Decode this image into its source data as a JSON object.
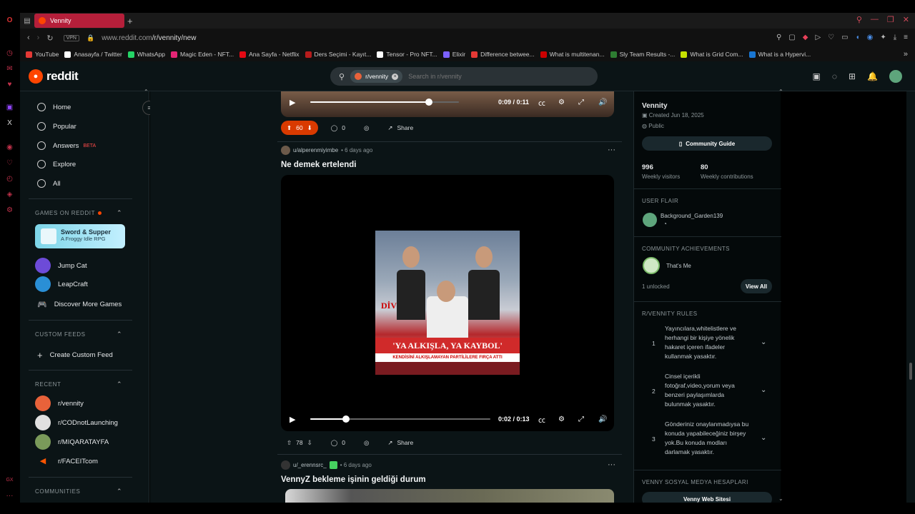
{
  "browser": {
    "tab_title": "Vennity",
    "url_host": "www.reddit.com",
    "url_path": "/r/vennity/new",
    "vpn_label": "VPN",
    "bookmarks": [
      {
        "label": "YouTube",
        "color": "#e53935"
      },
      {
        "label": "Anasayfa / Twitter",
        "color": "#ffffff"
      },
      {
        "label": "WhatsApp",
        "color": "#25d366"
      },
      {
        "label": "Magic Eden - NFT...",
        "color": "#e42575"
      },
      {
        "label": "Ana Sayfa - Netflix",
        "color": "#e50914"
      },
      {
        "label": "Ders Seçimi - Kayıt...",
        "color": "#b71c1c"
      },
      {
        "label": "Tensor - Pro NFT...",
        "color": "#ffffff"
      },
      {
        "label": "Elixir",
        "color": "#7b61ff"
      },
      {
        "label": "Difference betwee...",
        "color": "#e53935"
      },
      {
        "label": "What is multitenan...",
        "color": "#cc0000"
      },
      {
        "label": "Sly Team Results -...",
        "color": "#2e7d32"
      },
      {
        "label": "What is Grid Com...",
        "color": "#c6e000"
      },
      {
        "label": "What is a Hypervi...",
        "color": "#1976d2"
      }
    ]
  },
  "header": {
    "logo_text": "reddit",
    "search_chip": "r/vennity",
    "search_placeholder": "Search in r/vennity"
  },
  "sidebar": {
    "nav": [
      {
        "label": "Home"
      },
      {
        "label": "Popular"
      },
      {
        "label": "Answers",
        "badge": "BETA"
      },
      {
        "label": "Explore"
      },
      {
        "label": "All"
      }
    ],
    "games_heading": "GAMES ON REDDIT",
    "game_card": {
      "title": "Sword & Supper",
      "subtitle": "A Froggy Idle RPG"
    },
    "games": [
      {
        "label": "Jump Cat",
        "color": "#6d4bd8"
      },
      {
        "label": "LeapCraft",
        "color": "#2a8fd6"
      },
      {
        "label": "Discover More Games",
        "color": ""
      }
    ],
    "custom_feeds_heading": "CUSTOM FEEDS",
    "create_custom_feed": "Create Custom Feed",
    "recent_heading": "RECENT",
    "recent": [
      {
        "label": "r/vennity",
        "color": "#e8623a"
      },
      {
        "label": "r/CODnotLaunching",
        "color": "#e0e0e0"
      },
      {
        "label": "r/MIQARATAYFA",
        "color": "#7a9a5a"
      },
      {
        "label": "r/FACEITcom",
        "color": "#ff5500"
      }
    ],
    "communities_heading": "COMMUNITIES"
  },
  "feed": {
    "post_top": {
      "video_time": "0:09 / 0:11",
      "progress": 0.8,
      "votes": "60",
      "comments": "0",
      "share": "Share"
    },
    "post_main": {
      "author": "u/alperenmiyimbe",
      "age": "• 6 days ago",
      "title": "Ne demek ertelendi",
      "thumb_banner": "'YA ALKIŞLA, YA KAYBOL'",
      "thumb_sub": "KENDİSİNİ ALKIŞLAMAYAN PARTİLİLERE FIRÇA ATTI",
      "thumb_div": "DİV",
      "video_time": "0:02 / 0:13",
      "progress": 0.2,
      "votes": "78",
      "comments": "0",
      "share": "Share"
    },
    "post_next": {
      "author": "u/_erennsrc_",
      "age": "• 6 days ago",
      "title": "VennyZ bekleme işinin geldiği durum"
    }
  },
  "community": {
    "name": "Vennity",
    "created": "Created Jun 18, 2025",
    "visibility": "Public",
    "guide_button": "Community Guide",
    "stats": [
      {
        "value": "996",
        "label": "Weekly visitors"
      },
      {
        "value": "80",
        "label": "Weekly contributions"
      }
    ],
    "user_flair_heading": "USER FLAIR",
    "user_flair_name": "Background_Garden139",
    "achievements_heading": "COMMUNITY ACHIEVEMENTS",
    "achievement": "That's Me",
    "unlocked": "1 unlocked",
    "view_all": "View All",
    "rules_heading": "R/VENNITY RULES",
    "rules": [
      {
        "num": "1",
        "text": "Yayıncılara,whitelistlere ve herhangi bir kişiye yönelik hakaret içeren ifadeler kullanmak yasaktır."
      },
      {
        "num": "2",
        "text": "Cinsel içerikli fotoğraf,video,yorum veya benzeri paylaşımlarda bulunmak yasaktır."
      },
      {
        "num": "3",
        "text": "Gönderiniz onaylanmadıysa bu konuda yapabileceğiniz birşey yok.Bu konuda modları darlamak yasaktır."
      }
    ],
    "social_heading": "VENNY SOSYAL MEDYA HESAPLARI",
    "website_button": "Venny Web Sitesi"
  }
}
